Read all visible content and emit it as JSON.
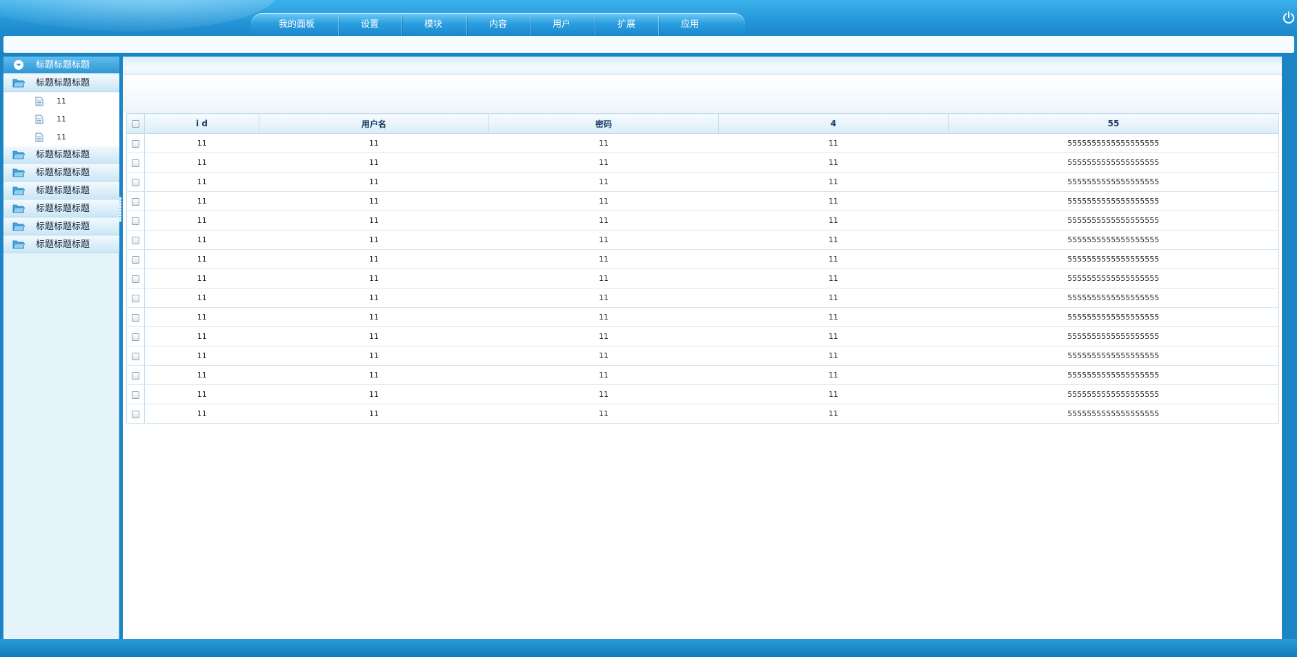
{
  "nav": {
    "items": [
      "我的面板",
      "设置",
      "模块",
      "内容",
      "用户",
      "扩展",
      "应用"
    ]
  },
  "sidebar": {
    "head": {
      "label": "标题标题标题"
    },
    "open_group": {
      "label": "标题标题标题",
      "children": [
        "11",
        "11",
        "11"
      ]
    },
    "groups": [
      "标题标题标题",
      "标题标题标题",
      "标题标题标题",
      "标题标题标题",
      "标题标题标题",
      "标题标题标题"
    ]
  },
  "table": {
    "columns": [
      "i d",
      "用户名",
      "密码",
      "4",
      "55"
    ],
    "rows": [
      [
        "11",
        "11",
        "11",
        "11",
        "5555555555555555555"
      ],
      [
        "11",
        "11",
        "11",
        "11",
        "5555555555555555555"
      ],
      [
        "11",
        "11",
        "11",
        "11",
        "5555555555555555555"
      ],
      [
        "11",
        "11",
        "11",
        "11",
        "5555555555555555555"
      ],
      [
        "11",
        "11",
        "11",
        "11",
        "5555555555555555555"
      ],
      [
        "11",
        "11",
        "11",
        "11",
        "5555555555555555555"
      ],
      [
        "11",
        "11",
        "11",
        "11",
        "5555555555555555555"
      ],
      [
        "11",
        "11",
        "11",
        "11",
        "5555555555555555555"
      ],
      [
        "11",
        "11",
        "11",
        "11",
        "5555555555555555555"
      ],
      [
        "11",
        "11",
        "11",
        "11",
        "5555555555555555555"
      ],
      [
        "11",
        "11",
        "11",
        "11",
        "5555555555555555555"
      ],
      [
        "11",
        "11",
        "11",
        "11",
        "5555555555555555555"
      ],
      [
        "11",
        "11",
        "11",
        "11",
        "5555555555555555555"
      ],
      [
        "11",
        "11",
        "11",
        "11",
        "5555555555555555555"
      ],
      [
        "11",
        "11",
        "11",
        "11",
        "5555555555555555555"
      ]
    ]
  },
  "icons": {
    "power": "power-icon",
    "sidebar_head": "chevron-down-circle-icon",
    "group": "folder-open-icon",
    "child": "document-icon"
  },
  "colors": {
    "header": "#2496d8",
    "accent": "#1a84c4",
    "sidebar_bg": "#e5f3fa",
    "table_header_text": "#1c3f66"
  }
}
